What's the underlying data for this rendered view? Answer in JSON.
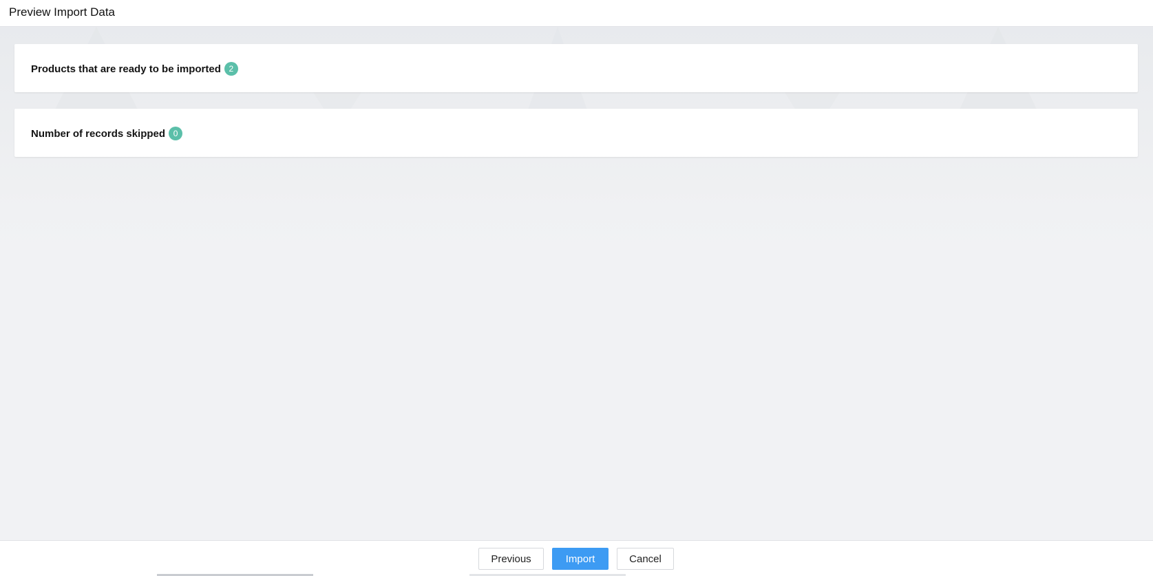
{
  "header": {
    "title": "Preview Import Data"
  },
  "summary": {
    "ready": {
      "label": "Products that are ready to be imported",
      "count": "2"
    },
    "skipped": {
      "label": "Number of records skipped",
      "count": "0"
    }
  },
  "footer": {
    "previous_label": "Previous",
    "import_label": "Import",
    "cancel_label": "Cancel"
  },
  "colors": {
    "badge": "#5bbfa9",
    "primary_button": "#3d9bf3",
    "background": "#f1f2f4"
  }
}
